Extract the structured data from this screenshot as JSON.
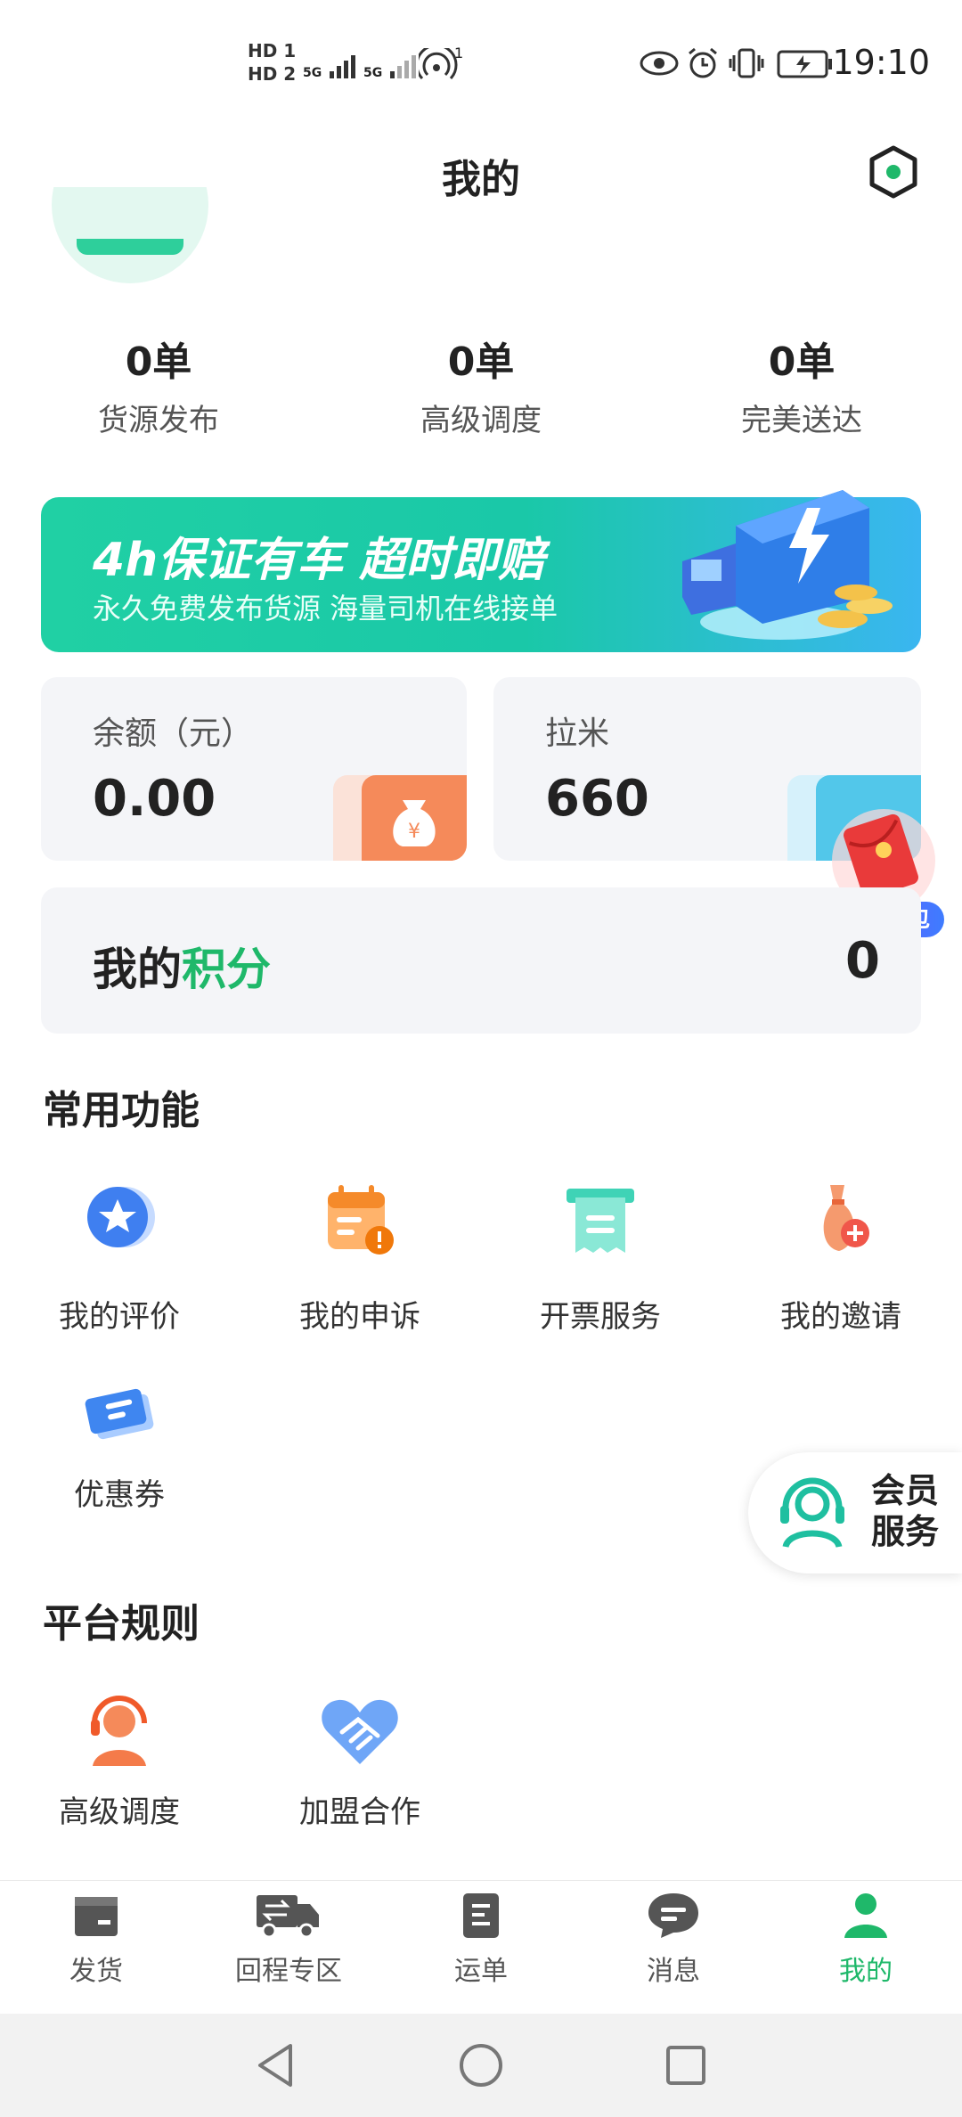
{
  "status_bar": {
    "sim1": "HD 1",
    "sim2": "HD 2",
    "net1": "5G",
    "net2": "5G",
    "hotspot_count": "1",
    "time": "19:10"
  },
  "header": {
    "title": "我的",
    "settings_icon": "hexagon-settings-icon"
  },
  "stats": [
    {
      "value": "0单",
      "label": "货源发布"
    },
    {
      "value": "0单",
      "label": "高级调度"
    },
    {
      "value": "0单",
      "label": "完美送达"
    }
  ],
  "banner": {
    "title": "4h保证有车 超时即赔",
    "subtitle": "永久免费发布货源  海量司机在线接单"
  },
  "balance_card": {
    "label": "余额（元）",
    "value": "0.00"
  },
  "lami_card": {
    "label": "拉米",
    "value": "660"
  },
  "gift_badge": "献礼红包",
  "points": {
    "label_prefix": "我的",
    "label_highlight": "积分",
    "value": "0"
  },
  "common_functions": {
    "title": "常用功能",
    "items": [
      {
        "label": "我的评价",
        "icon": "star-badge-icon"
      },
      {
        "label": "我的申诉",
        "icon": "calendar-alert-icon"
      },
      {
        "label": "开票服务",
        "icon": "invoice-icon"
      },
      {
        "label": "我的邀请",
        "icon": "invite-icon"
      },
      {
        "label": "优惠券",
        "icon": "coupon-icon"
      }
    ]
  },
  "member_service": {
    "line1": "会员",
    "line2": "服务"
  },
  "platform_rules": {
    "title": "平台规则",
    "items": [
      {
        "label": "高级调度",
        "icon": "headset-agent-icon"
      },
      {
        "label": "加盟合作",
        "icon": "handshake-heart-icon"
      }
    ]
  },
  "bottom_nav": [
    {
      "label": "发货",
      "icon": "box-icon",
      "active": false
    },
    {
      "label": "回程专区",
      "icon": "truck-icon",
      "active": false
    },
    {
      "label": "运单",
      "icon": "document-icon",
      "active": false
    },
    {
      "label": "消息",
      "icon": "chat-icon",
      "active": false
    },
    {
      "label": "我的",
      "icon": "person-icon",
      "active": true
    }
  ],
  "colors": {
    "accent": "#1fb86a",
    "banner_start": "#20d0a4",
    "banner_end": "#3ab6f0",
    "card_bg": "#f4f5f8"
  }
}
